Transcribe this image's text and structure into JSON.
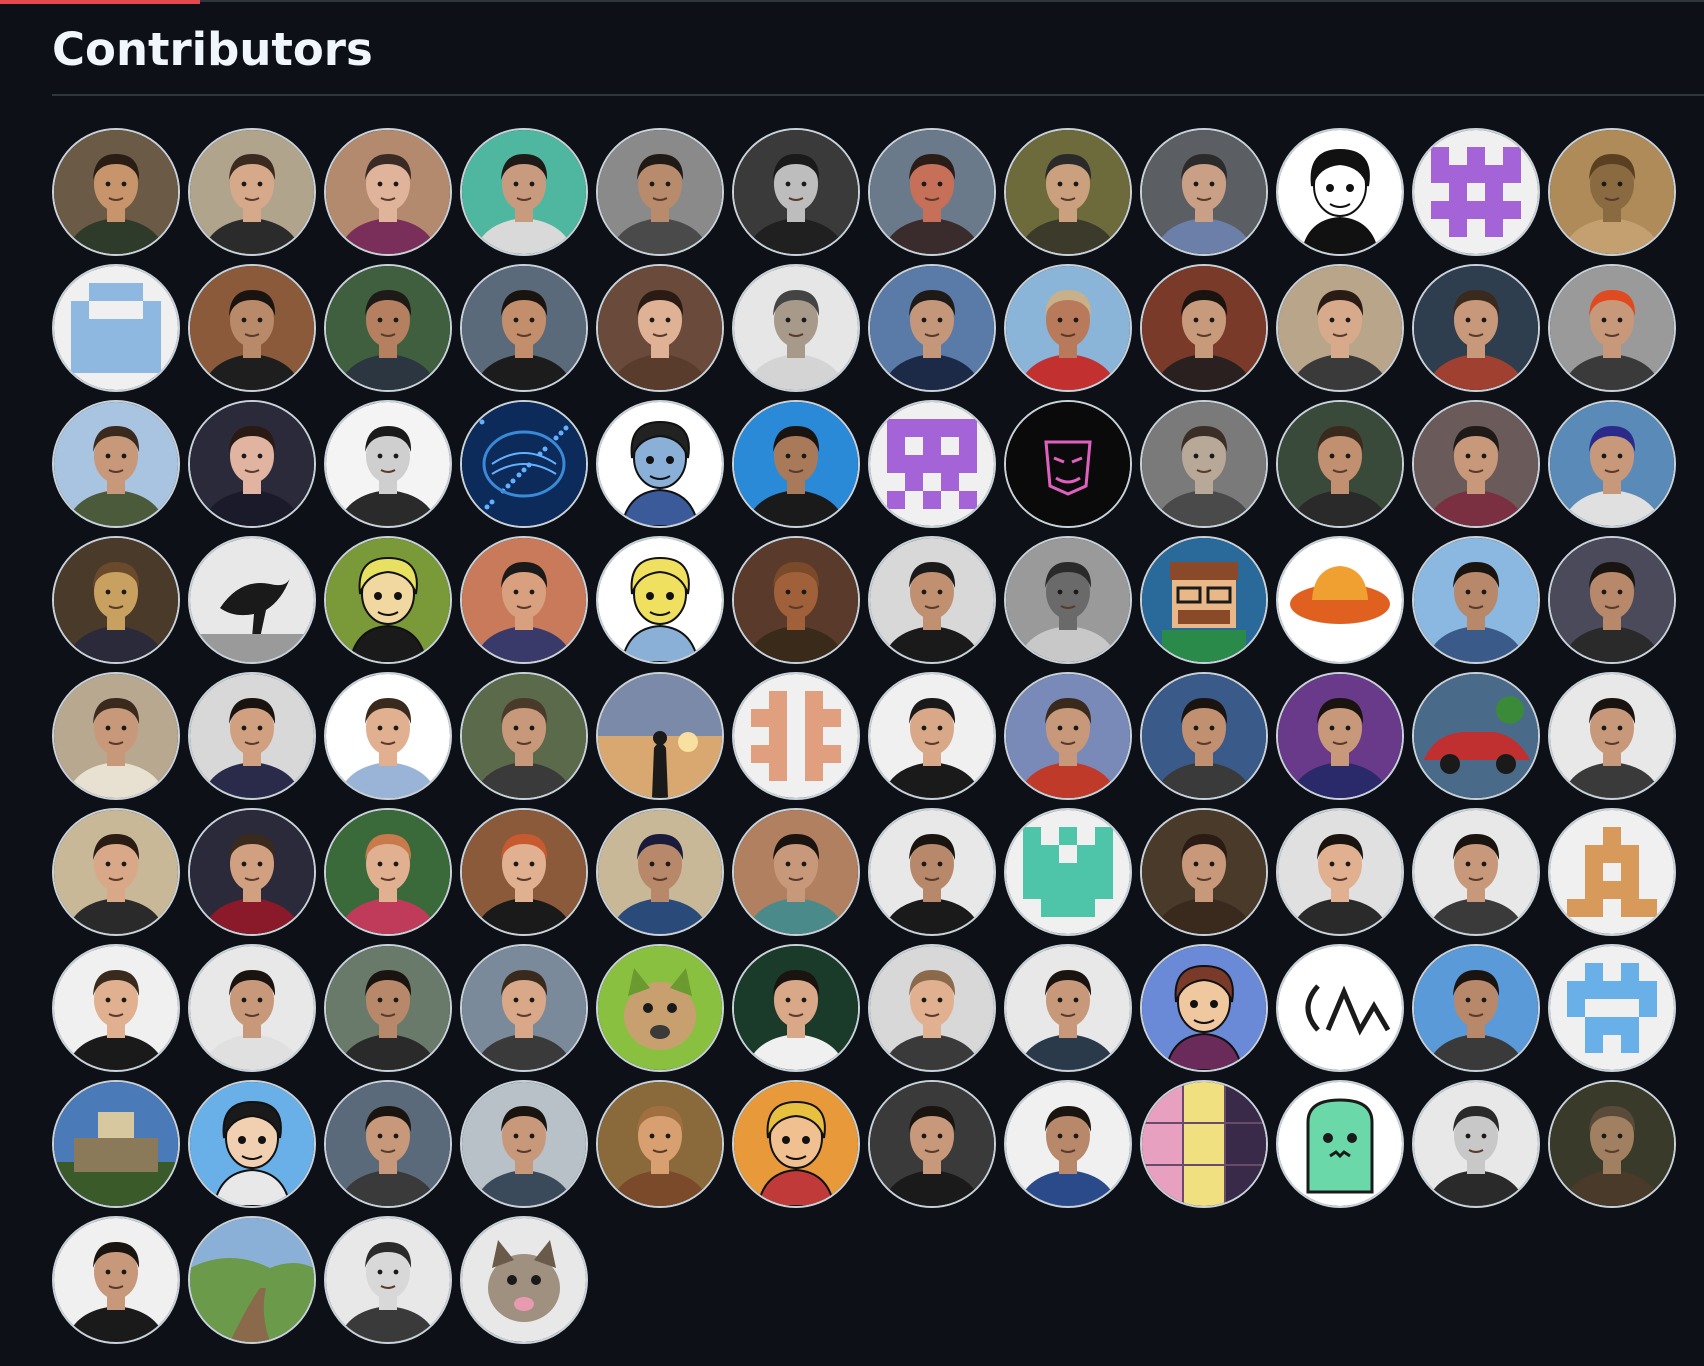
{
  "section": {
    "title": "Contributors"
  },
  "contributors": [
    {
      "kind": "photo",
      "bg": "#6b5a45",
      "skin": "#c7946c",
      "hair": "#2a1d14",
      "shirt": "#2f3b2a"
    },
    {
      "kind": "photo",
      "bg": "#b0a48d",
      "skin": "#d7a98b",
      "hair": "#3b2a20",
      "shirt": "#2b2b2b"
    },
    {
      "kind": "photo",
      "bg": "#b48a6e",
      "skin": "#e0b49a",
      "hair": "#3a2a25",
      "shirt": "#7a2f5a"
    },
    {
      "kind": "photo",
      "bg": "#4fb7a0",
      "skin": "#c99b7e",
      "hair": "#1e1a17",
      "shirt": "#d9d9d9"
    },
    {
      "kind": "photo",
      "bg": "#8a8a8a",
      "skin": "#b78b6b",
      "hair": "#1f1a16",
      "shirt": "#4a4a4a"
    },
    {
      "kind": "photo",
      "bg": "#3a3a3a",
      "skin": "#bdbdbd",
      "hair": "#1a1a1a",
      "shirt": "#202020"
    },
    {
      "kind": "photo",
      "bg": "#6b7a8a",
      "skin": "#c6705a",
      "hair": "#2a1c16",
      "shirt": "#3a2c2c"
    },
    {
      "kind": "photo",
      "bg": "#6d6a3c",
      "skin": "#caa07f",
      "hair": "#2a2a2a",
      "shirt": "#3c3a2a"
    },
    {
      "kind": "photo",
      "bg": "#5b5e63",
      "skin": "#c9a085",
      "hair": "#2b2b2b",
      "shirt": "#6b7fa8"
    },
    {
      "kind": "drawing",
      "bg": "#ffffff",
      "skin": "#ffffff",
      "hair": "#111111",
      "shirt": "#111111"
    },
    {
      "kind": "identicon",
      "bg": "#f0f0f0",
      "fg": "#a463d6",
      "pattern": [
        1,
        0,
        1,
        0,
        1,
        1,
        1,
        1,
        1,
        1,
        0,
        1,
        0,
        1,
        0,
        1,
        1,
        1,
        1,
        1,
        0,
        1,
        0,
        1,
        0
      ]
    },
    {
      "kind": "photo",
      "bg": "#b08b5a",
      "skin": "#8a6a40",
      "hair": "#5a4020",
      "shirt": "#c4a070"
    },
    {
      "kind": "identicon",
      "bg": "#f0f0f0",
      "fg": "#8fb8e0",
      "pattern": [
        0,
        1,
        1,
        1,
        0,
        1,
        0,
        0,
        0,
        1,
        1,
        1,
        1,
        1,
        1,
        1,
        1,
        1,
        1,
        1,
        1,
        1,
        1,
        1,
        1
      ]
    },
    {
      "kind": "photo",
      "bg": "#8a5a3a",
      "skin": "#b88a6a",
      "hair": "#1a1410",
      "shirt": "#1e1e1e"
    },
    {
      "kind": "photo",
      "bg": "#3f5f3f",
      "skin": "#b48060",
      "hair": "#1e1a17",
      "shirt": "#2b3640"
    },
    {
      "kind": "photo",
      "bg": "#5a6a7a",
      "skin": "#c28e6c",
      "hair": "#1a1410",
      "shirt": "#1c1c1c"
    },
    {
      "kind": "photo",
      "bg": "#6a4a3a",
      "skin": "#e0b295",
      "hair": "#2a1c14",
      "shirt": "#5a3c2c"
    },
    {
      "kind": "photo",
      "bg": "#e6e6e6",
      "skin": "#a89a8a",
      "hair": "#444444",
      "shirt": "#d4d4d4"
    },
    {
      "kind": "photo",
      "bg": "#5a7aa8",
      "skin": "#c4967a",
      "hair": "#1e1a17",
      "shirt": "#1c2a48"
    },
    {
      "kind": "photo",
      "bg": "#8ab4d8",
      "skin": "#b87a5a",
      "hair": "#c8b08a",
      "shirt": "#c23030"
    },
    {
      "kind": "photo",
      "bg": "#7a3a2a",
      "skin": "#c89a7c",
      "hair": "#1a1410",
      "shirt": "#2a2020"
    },
    {
      "kind": "photo",
      "bg": "#b9a58a",
      "skin": "#d8aa8c",
      "hair": "#2a1c14",
      "shirt": "#3a3a3a"
    },
    {
      "kind": "photo",
      "bg": "#2e3e4e",
      "skin": "#c8987a",
      "hair": "#3a2a1e",
      "shirt": "#a04030"
    },
    {
      "kind": "photo",
      "bg": "#9a9a9a",
      "skin": "#c8987a",
      "hair": "#e04a20",
      "shirt": "#3a3a3a"
    },
    {
      "kind": "photo",
      "bg": "#a8c4e0",
      "skin": "#c8987a",
      "hair": "#3a2a1e",
      "shirt": "#4a5a3a"
    },
    {
      "kind": "photo",
      "bg": "#2a2a3a",
      "skin": "#e0b4a0",
      "hair": "#2a1a14",
      "shirt": "#1a1a2a"
    },
    {
      "kind": "photo",
      "bg": "#f4f4f4",
      "skin": "#cfcfcf",
      "hair": "#1a1a1a",
      "shirt": "#2a2a2a"
    },
    {
      "kind": "brain",
      "bg": "#0c2a5a",
      "skin": "#3a8ad8",
      "hair": "#62b0ff",
      "shirt": "#0c2a5a"
    },
    {
      "kind": "drawing",
      "bg": "#ffffff",
      "skin": "#8ab0d8",
      "hair": "#222222",
      "shirt": "#3a5a9a"
    },
    {
      "kind": "photo",
      "bg": "#2a8ad8",
      "skin": "#a87a5a",
      "hair": "#1a1410",
      "shirt": "#1a1a1a"
    },
    {
      "kind": "identicon",
      "bg": "#f0f0f0",
      "fg": "#a463d6",
      "pattern": [
        1,
        1,
        1,
        1,
        1,
        1,
        0,
        1,
        0,
        1,
        1,
        1,
        1,
        1,
        1,
        0,
        1,
        0,
        1,
        0,
        1,
        0,
        1,
        0,
        1
      ]
    },
    {
      "kind": "mask",
      "bg": "#0a0a0a",
      "skin": "#e060c0",
      "hair": "#0a0a0a",
      "shirt": "#0a0a0a"
    },
    {
      "kind": "photo",
      "bg": "#7a7a7a",
      "skin": "#b8a898",
      "hair": "#3a2e26",
      "shirt": "#4a4a4a"
    },
    {
      "kind": "photo",
      "bg": "#3a4a3a",
      "skin": "#c09070",
      "hair": "#3a2a1e",
      "shirt": "#2a2a2a"
    },
    {
      "kind": "photo",
      "bg": "#6a5a5a",
      "skin": "#c8987a",
      "hair": "#1e1a17",
      "shirt": "#7a3040"
    },
    {
      "kind": "photo",
      "bg": "#5a8ab8",
      "skin": "#c8987a",
      "hair": "#2a2a8a",
      "shirt": "#e0e0e0"
    },
    {
      "kind": "photo",
      "bg": "#4a3a2a",
      "skin": "#c8a060",
      "hair": "#6a4a2a",
      "shirt": "#2a2a3a"
    },
    {
      "kind": "bird",
      "bg": "#e8e8e8",
      "skin": "#1a1a1a",
      "hair": "#1a1a1a",
      "shirt": "#9a9a9a"
    },
    {
      "kind": "drawing",
      "bg": "#7a9a3a",
      "skin": "#f0d8a0",
      "hair": "#e8e060",
      "shirt": "#1a1a1a"
    },
    {
      "kind": "photo",
      "bg": "#c87a5a",
      "skin": "#d8a07e",
      "hair": "#1a1a1a",
      "shirt": "#3a3a6a"
    },
    {
      "kind": "drawing",
      "bg": "#ffffff",
      "skin": "#f0e060",
      "hair": "#f0e060",
      "shirt": "#8ab0d8"
    },
    {
      "kind": "photo",
      "bg": "#5a3a2a",
      "skin": "#a0603a",
      "hair": "#7a4a2a",
      "shirt": "#3a2a1a"
    },
    {
      "kind": "photo",
      "bg": "#d8d8d8",
      "skin": "#c09070",
      "hair": "#1a1a1a",
      "shirt": "#1a1a1a"
    },
    {
      "kind": "photo",
      "bg": "#9a9a9a",
      "skin": "#6a6a6a",
      "hair": "#2a2a2a",
      "shirt": "#c8c8c8"
    },
    {
      "kind": "pixel",
      "bg": "#2a6a9a",
      "skin": "#e8b888",
      "hair": "#8a4a2a",
      "shirt": "#2a8a4a"
    },
    {
      "kind": "hat",
      "bg": "#ffffff",
      "skin": "#f0a030",
      "hair": "#e06020",
      "shirt": "#3a3a3a"
    },
    {
      "kind": "photo",
      "bg": "#8ab8e0",
      "skin": "#b8886a",
      "hair": "#1a1410",
      "shirt": "#3a5a8a"
    },
    {
      "kind": "photo",
      "bg": "#4a4a5a",
      "skin": "#b8886a",
      "hair": "#1a1410",
      "shirt": "#2a2a2a"
    },
    {
      "kind": "photo",
      "bg": "#b8a890",
      "skin": "#c8987a",
      "hair": "#3a2a1e",
      "shirt": "#e8e0d0"
    },
    {
      "kind": "photo",
      "bg": "#d8d8d8",
      "skin": "#d0a080",
      "hair": "#1a1410",
      "shirt": "#2a2a4a"
    },
    {
      "kind": "photo",
      "bg": "#ffffff",
      "skin": "#e0b090",
      "hair": "#3a2a1e",
      "shirt": "#9ab4d8"
    },
    {
      "kind": "photo",
      "bg": "#5a6a4a",
      "skin": "#c8987a",
      "hair": "#4a3a2a",
      "shirt": "#3a3a3a"
    },
    {
      "kind": "sunset",
      "bg": "#d8a870",
      "skin": "#1a1a1a",
      "hair": "#1a1a1a",
      "shirt": "#4a3a2a"
    },
    {
      "kind": "identicon",
      "bg": "#f0f0f0",
      "fg": "#e0a080",
      "pattern": [
        0,
        1,
        0,
        1,
        0,
        1,
        1,
        0,
        1,
        1,
        0,
        1,
        0,
        1,
        0,
        1,
        1,
        0,
        1,
        1,
        0,
        1,
        0,
        1,
        0
      ]
    },
    {
      "kind": "photo",
      "bg": "#f0f0f0",
      "skin": "#d8a888",
      "hair": "#1a1a1a",
      "shirt": "#1a1a1a"
    },
    {
      "kind": "photo",
      "bg": "#7a8ab8",
      "skin": "#c8987a",
      "hair": "#3a2a1e",
      "shirt": "#c03a2a"
    },
    {
      "kind": "photo",
      "bg": "#3a5a8a",
      "skin": "#c09070",
      "hair": "#1a1410",
      "shirt": "#3a3a3a"
    },
    {
      "kind": "photo",
      "bg": "#6a3a8a",
      "skin": "#c8987a",
      "hair": "#1a1410",
      "shirt": "#2a2a6a"
    },
    {
      "kind": "car",
      "bg": "#4a6a8a",
      "skin": "#c03030",
      "hair": "#3a8a3a",
      "shirt": "#1a1a1a"
    },
    {
      "kind": "photo",
      "bg": "#e8e8e8",
      "skin": "#c8987a",
      "hair": "#1a1410",
      "shirt": "#3a3a3a"
    },
    {
      "kind": "photo",
      "bg": "#c8b898",
      "skin": "#d8a888",
      "hair": "#2a1c14",
      "shirt": "#2a2a2a"
    },
    {
      "kind": "photo",
      "bg": "#2a2a3a",
      "skin": "#d0a080",
      "hair": "#3a2a1e",
      "shirt": "#8a1a2a"
    },
    {
      "kind": "photo",
      "bg": "#3a6a3a",
      "skin": "#e0b090",
      "hair": "#c87a4a",
      "shirt": "#c03a5a"
    },
    {
      "kind": "photo",
      "bg": "#8a5a3a",
      "skin": "#e0b090",
      "hair": "#c85a30",
      "shirt": "#1a1a1a"
    },
    {
      "kind": "photo",
      "bg": "#c8b898",
      "skin": "#b8886a",
      "hair": "#1a1a3a",
      "shirt": "#2a4a7a"
    },
    {
      "kind": "photo",
      "bg": "#b08060",
      "skin": "#c8987a",
      "hair": "#1a1410",
      "shirt": "#4a8a8a"
    },
    {
      "kind": "photo",
      "bg": "#e8e8e8",
      "skin": "#b8886a",
      "hair": "#1a1410",
      "shirt": "#1a1a1a"
    },
    {
      "kind": "identicon",
      "bg": "#f0f0f0",
      "fg": "#4ec4a8",
      "pattern": [
        1,
        0,
        1,
        0,
        1,
        1,
        1,
        0,
        1,
        1,
        1,
        1,
        1,
        1,
        1,
        1,
        1,
        1,
        1,
        1,
        0,
        1,
        1,
        1,
        0
      ]
    },
    {
      "kind": "photo",
      "bg": "#4a3a2a",
      "skin": "#c8987a",
      "hair": "#2a1c14",
      "shirt": "#3a2a1e"
    },
    {
      "kind": "photo",
      "bg": "#e0e0e0",
      "skin": "#e0b090",
      "hair": "#1a1410",
      "shirt": "#2a2a2a"
    },
    {
      "kind": "photo",
      "bg": "#e8e8e8",
      "skin": "#c8987a",
      "hair": "#1a1410",
      "shirt": "#3a3a3a"
    },
    {
      "kind": "identicon",
      "bg": "#f0f0f0",
      "fg": "#d89a5a",
      "pattern": [
        0,
        0,
        1,
        0,
        0,
        0,
        1,
        1,
        1,
        0,
        0,
        1,
        0,
        1,
        0,
        0,
        1,
        1,
        1,
        0,
        1,
        1,
        0,
        1,
        1
      ]
    },
    {
      "kind": "photo",
      "bg": "#f0f0f0",
      "skin": "#e0b090",
      "hair": "#3a2a1e",
      "shirt": "#1a1a1a"
    },
    {
      "kind": "photo",
      "bg": "#e8e8e8",
      "skin": "#c8987a",
      "hair": "#1a1410",
      "shirt": "#e0e0e0"
    },
    {
      "kind": "photo",
      "bg": "#6a7a6a",
      "skin": "#b8886a",
      "hair": "#1a1410",
      "shirt": "#2a2a2a"
    },
    {
      "kind": "photo",
      "bg": "#7a8a9a",
      "skin": "#d8a888",
      "hair": "#3a2a1e",
      "shirt": "#3a3a3a"
    },
    {
      "kind": "cat",
      "bg": "#8ac040",
      "skin": "#c8a070",
      "hair": "#6a9a30",
      "shirt": "#3a3a3a"
    },
    {
      "kind": "photo",
      "bg": "#1a3a2a",
      "skin": "#d8a888",
      "hair": "#1a1410",
      "shirt": "#f0f0f0"
    },
    {
      "kind": "photo",
      "bg": "#d8d8d8",
      "skin": "#e0b090",
      "hair": "#8a6a4a",
      "shirt": "#3a3a3a"
    },
    {
      "kind": "photo",
      "bg": "#e8e8e8",
      "skin": "#c8987a",
      "hair": "#1a1410",
      "shirt": "#2a3a4a"
    },
    {
      "kind": "drawing",
      "bg": "#6a8ad8",
      "skin": "#f0c8a0",
      "hair": "#7a3a2a",
      "shirt": "#6a2a5a"
    },
    {
      "kind": "logo",
      "bg": "#ffffff",
      "skin": "#1a1a1a",
      "hair": "#1a1a1a",
      "shirt": "#ffffff"
    },
    {
      "kind": "photo",
      "bg": "#5a9ad8",
      "skin": "#b8886a",
      "hair": "#1a1410",
      "shirt": "#3a3a3a"
    },
    {
      "kind": "identicon",
      "bg": "#f0f0f0",
      "fg": "#6ab0e8",
      "pattern": [
        0,
        1,
        0,
        1,
        0,
        1,
        1,
        1,
        1,
        1,
        1,
        0,
        0,
        0,
        1,
        0,
        1,
        1,
        1,
        0,
        0,
        1,
        0,
        1,
        0
      ]
    },
    {
      "kind": "castle",
      "bg": "#4a7ab8",
      "skin": "#d8c8a0",
      "hair": "#8a7a5a",
      "shirt": "#3a5a2a"
    },
    {
      "kind": "drawing",
      "bg": "#6ab0e8",
      "skin": "#f0d0b0",
      "hair": "#1a1a1a",
      "shirt": "#e8e8e8"
    },
    {
      "kind": "photo",
      "bg": "#5a6a7a",
      "skin": "#c8987a",
      "hair": "#1a1410",
      "shirt": "#3a3a3a"
    },
    {
      "kind": "photo",
      "bg": "#b8c0c8",
      "skin": "#c8987a",
      "hair": "#1a1410",
      "shirt": "#3a4a5a"
    },
    {
      "kind": "photo",
      "bg": "#8a6a3a",
      "skin": "#d8a070",
      "hair": "#a07040",
      "shirt": "#7a4a2a"
    },
    {
      "kind": "drawing",
      "bg": "#e89a3a",
      "skin": "#f0c090",
      "hair": "#e8c040",
      "shirt": "#c03a3a"
    },
    {
      "kind": "photo",
      "bg": "#3a3a3a",
      "skin": "#c8987a",
      "hair": "#1a1410",
      "shirt": "#1a1a1a"
    },
    {
      "kind": "photo",
      "bg": "#f0f0f0",
      "skin": "#b8886a",
      "hair": "#1a1410",
      "shirt": "#2a4a8a"
    },
    {
      "kind": "collage",
      "bg": "#6a4a6a",
      "skin": "#e8a0c0",
      "hair": "#f0e080",
      "shirt": "#3a2a4a"
    },
    {
      "kind": "monster",
      "bg": "#ffffff",
      "skin": "#6ad8a8",
      "hair": "#1a1a1a",
      "shirt": "#ffffff"
    },
    {
      "kind": "photo",
      "bg": "#e8e8e8",
      "skin": "#c8c8c8",
      "hair": "#2a2a2a",
      "shirt": "#2a2a2a"
    },
    {
      "kind": "photo",
      "bg": "#3a3a2a",
      "skin": "#a08060",
      "hair": "#5a4a3a",
      "shirt": "#4a3a2a"
    },
    {
      "kind": "photo",
      "bg": "#f0f0f0",
      "skin": "#c8987a",
      "hair": "#1a1410",
      "shirt": "#1a1a1a"
    },
    {
      "kind": "landscape",
      "bg": "#8ab0d8",
      "skin": "#6a9a4a",
      "hair": "#8a6a4a",
      "shirt": "#3a3a3a"
    },
    {
      "kind": "photo",
      "bg": "#e8e8e8",
      "skin": "#d8d8d8",
      "hair": "#2a2a2a",
      "shirt": "#3a3a3a"
    },
    {
      "kind": "cat",
      "bg": "#e8e8e8",
      "skin": "#a09080",
      "hair": "#6a5a4a",
      "shirt": "#e89ab0"
    }
  ]
}
